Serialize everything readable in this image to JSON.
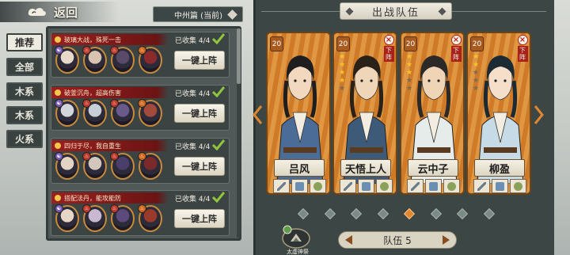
{
  "header": {
    "back_label": "返回",
    "chapter": "中州篇 (当前)"
  },
  "categories": [
    "推荐",
    "全部",
    "木系",
    "木系",
    "火系"
  ],
  "combos": [
    {
      "title": "玻璃大战，殊死一击",
      "count": "已收集 4/4",
      "button": "一键上阵"
    },
    {
      "title": "破釜沉舟，超高伤害",
      "count": "已收集 4/4",
      "button": "一键上阵"
    },
    {
      "title": "四归于尽，我自重生",
      "count": "已收集 4/4",
      "button": "一键上阵"
    },
    {
      "title": "搭配法丹，能攻能防",
      "count": "已收集 4/4",
      "button": "一键上阵"
    }
  ],
  "team": {
    "title": "出战队伍",
    "team_label": "队伍 5",
    "heroes": [
      {
        "name": "吕风",
        "level": "20",
        "stars": 0,
        "removable": false,
        "robe": "#4a6c97",
        "skin": "#f1d8bf",
        "hair": "#1e1e1e"
      },
      {
        "name": "天悟上人",
        "level": "20",
        "stars": 4,
        "removable": true,
        "remove_label": "下阵",
        "robe": "#3d5a78",
        "skin": "#f0d6b8",
        "hair": "#2a2218"
      },
      {
        "name": "云中子",
        "level": "20",
        "stars": 3,
        "removable": true,
        "remove_label": "下阵",
        "robe": "#e6ecea",
        "skin": "#efd5b6",
        "hair": "#2b2a28"
      },
      {
        "name": "柳盈",
        "level": "20",
        "stars": 2,
        "removable": true,
        "remove_label": "下阵",
        "robe": "#c6dbe5",
        "skin": "#f5dfca",
        "hair": "#1c2a33"
      }
    ],
    "page_count": 8,
    "active_page": 5
  },
  "taixu": {
    "label": "太虚神祭"
  },
  "colors": {
    "accent": "#e08730",
    "banner": "#9b1f1f",
    "card": "#d9832d"
  }
}
